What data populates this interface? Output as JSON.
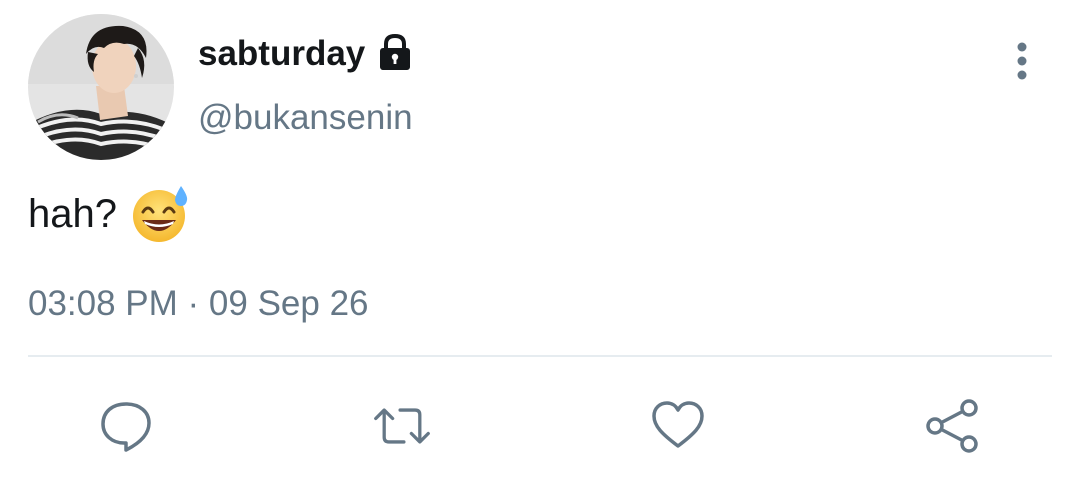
{
  "tweet": {
    "display_name": "sabturday",
    "handle": "@bukansenin",
    "text": "hah?",
    "timestamp": "03:08 PM · 09 Sep 26"
  },
  "icons": {
    "lock": "lock-icon",
    "more": "more-vertical-icon",
    "emoji": "grinning-face-with-sweat-emoji",
    "reply": "reply-icon",
    "retweet": "retweet-icon",
    "like": "heart-icon",
    "share": "share-icon"
  },
  "colors": {
    "text_primary": "#14171a",
    "text_secondary": "#657786",
    "divider": "#e6ecf0"
  }
}
